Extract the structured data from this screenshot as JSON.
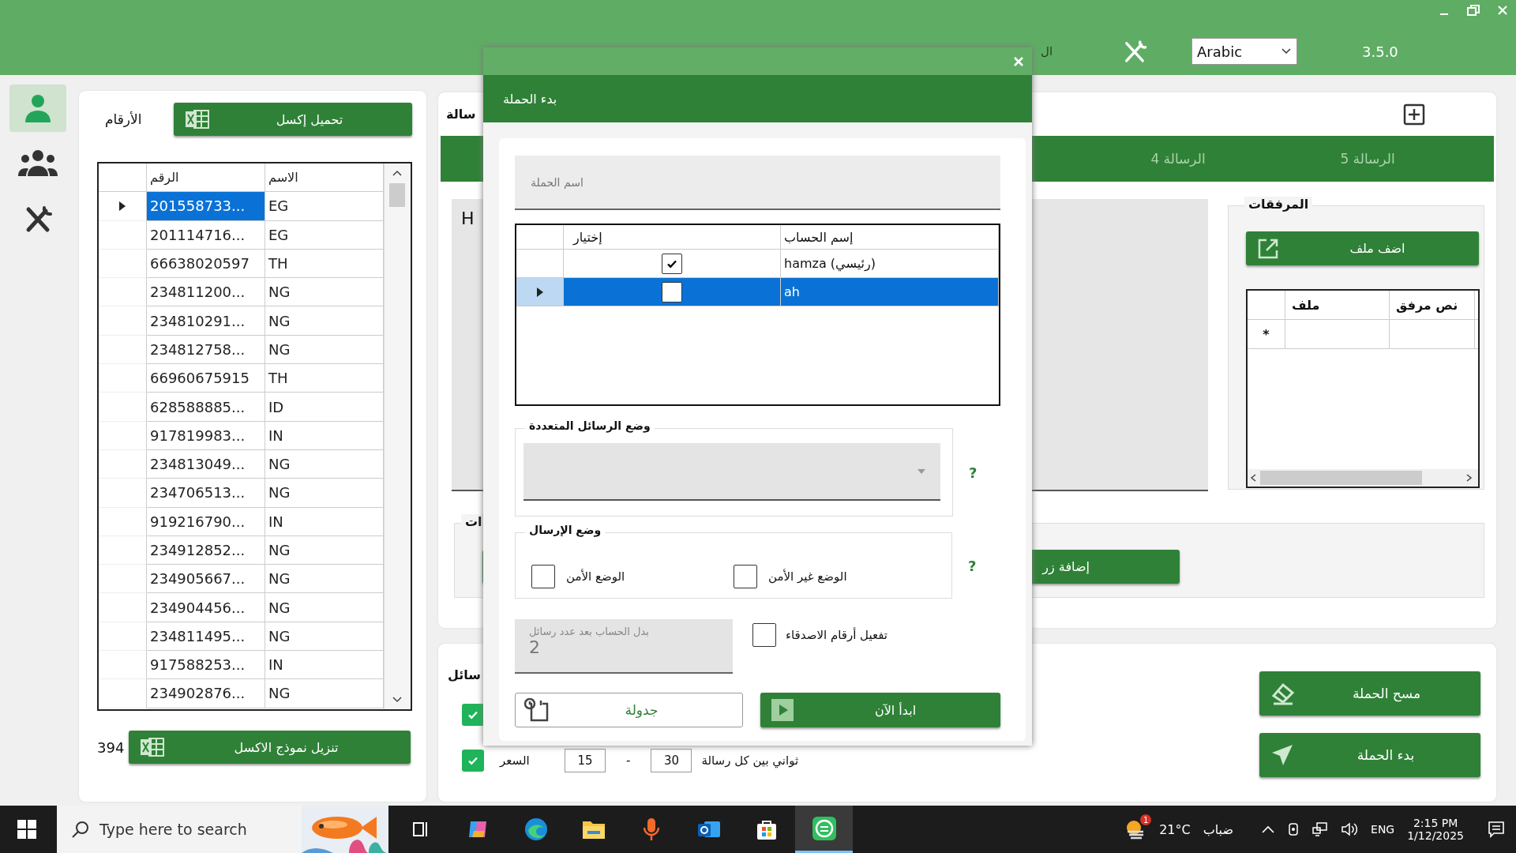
{
  "header": {
    "partial_label": "ال",
    "language": "Arabic",
    "version": "3.5.0"
  },
  "sidebar": {
    "items": [
      {
        "kind": "person",
        "selected": true
      },
      {
        "kind": "group",
        "selected": false
      },
      {
        "kind": "tools",
        "selected": false
      }
    ]
  },
  "numbers_panel": {
    "title": "الأرقام",
    "load_button": "تحميل إكسل",
    "columns": [
      "الاسم",
      "الرقم"
    ],
    "rows": [
      {
        "number": "201558733...",
        "name": "EG",
        "selected": true
      },
      {
        "number": "201114716...",
        "name": "EG",
        "selected": false
      },
      {
        "number": "66638020597",
        "name": "TH",
        "selected": false
      },
      {
        "number": "234811200...",
        "name": "NG",
        "selected": false
      },
      {
        "number": "234810291...",
        "name": "NG",
        "selected": false
      },
      {
        "number": "234812758...",
        "name": "NG",
        "selected": false
      },
      {
        "number": "66960675915",
        "name": "TH",
        "selected": false
      },
      {
        "number": "628588885...",
        "name": "ID",
        "selected": false
      },
      {
        "number": "917819983...",
        "name": "IN",
        "selected": false
      },
      {
        "number": "234813049...",
        "name": "NG",
        "selected": false
      },
      {
        "number": "234706513...",
        "name": "NG",
        "selected": false
      },
      {
        "number": "919216790...",
        "name": "IN",
        "selected": false
      },
      {
        "number": "234912852...",
        "name": "NG",
        "selected": false
      },
      {
        "number": "234905667...",
        "name": "NG",
        "selected": false
      },
      {
        "number": "234904456...",
        "name": "NG",
        "selected": false
      },
      {
        "number": "234811495...",
        "name": "NG",
        "selected": false
      },
      {
        "number": "917588253...",
        "name": "IN",
        "selected": false
      },
      {
        "number": "234902876...",
        "name": "NG",
        "selected": false
      }
    ],
    "count": "394",
    "template_button": "تنزيل نموذج الاكسل"
  },
  "message_panel": {
    "title_partial": "سالة",
    "tabs": [
      {
        "label": "الرسالة 5",
        "selected": false
      },
      {
        "label": "الرسالة 4",
        "selected": false
      }
    ],
    "editor_text": "H",
    "attachments": {
      "title": "المرفقات",
      "add_button": "اضف ملف",
      "columns": [
        "نص مرفق",
        "ملف"
      ],
      "new_row_mark": "*"
    },
    "buttons_group": {
      "title_partial": "ات",
      "add_button": "إضافة زر"
    }
  },
  "options_panel": {
    "title_partial": "سائل",
    "rows": [
      {
        "checked": true
      },
      {
        "checked": true,
        "label": "السعر",
        "min": "15",
        "separator": "-",
        "max": "30",
        "suffix": "ثواني بين كل رسالة"
      }
    ]
  },
  "actions": [
    {
      "kind": "eraser",
      "label": "مسح الحملة"
    },
    {
      "kind": "send",
      "label": "بدء الحملة"
    }
  ],
  "dialog": {
    "title": "بدء الحملة",
    "name_placeholder": "اسم الحملة",
    "accounts": {
      "columns": [
        "إسم الحساب",
        "إختيار"
      ],
      "rows": [
        {
          "checked": true,
          "name": "hamza (رئيسي)",
          "selected": false
        },
        {
          "checked": false,
          "name": "ah",
          "selected": true
        }
      ]
    },
    "multi_mode": {
      "title": "وضع الرسائل المتعددة",
      "help": "?"
    },
    "send_mode": {
      "title": "وضع الإرسال",
      "help": "?",
      "options": [
        {
          "label": "الوضع غير الأمن",
          "checked": false
        },
        {
          "label": "الوضع الأمن",
          "checked": false
        }
      ]
    },
    "switch_after": {
      "label": "بدل الحساب بعد عدد رسائل",
      "value": "2"
    },
    "friends": {
      "label": "تفعيل أرقام الاصدقاء",
      "checked": false
    },
    "schedule_button": "جدولة",
    "start_button": "ابدأ الآن"
  },
  "taskbar": {
    "search_placeholder": "Type here to search",
    "apps": [
      {
        "kind": "taskview",
        "active": false
      },
      {
        "kind": "copilot",
        "active": false
      },
      {
        "kind": "edge",
        "active": false
      },
      {
        "kind": "folder",
        "active": false
      },
      {
        "kind": "mic",
        "active": false
      },
      {
        "kind": "outlook",
        "active": false
      },
      {
        "kind": "store",
        "active": false
      },
      {
        "kind": "app",
        "active": true
      }
    ],
    "weather": {
      "badge": "1",
      "temperature": "21°C",
      "condition": "ضباب"
    },
    "language": "ENG",
    "time": "2:15 PM",
    "date": "1/12/2025"
  }
}
